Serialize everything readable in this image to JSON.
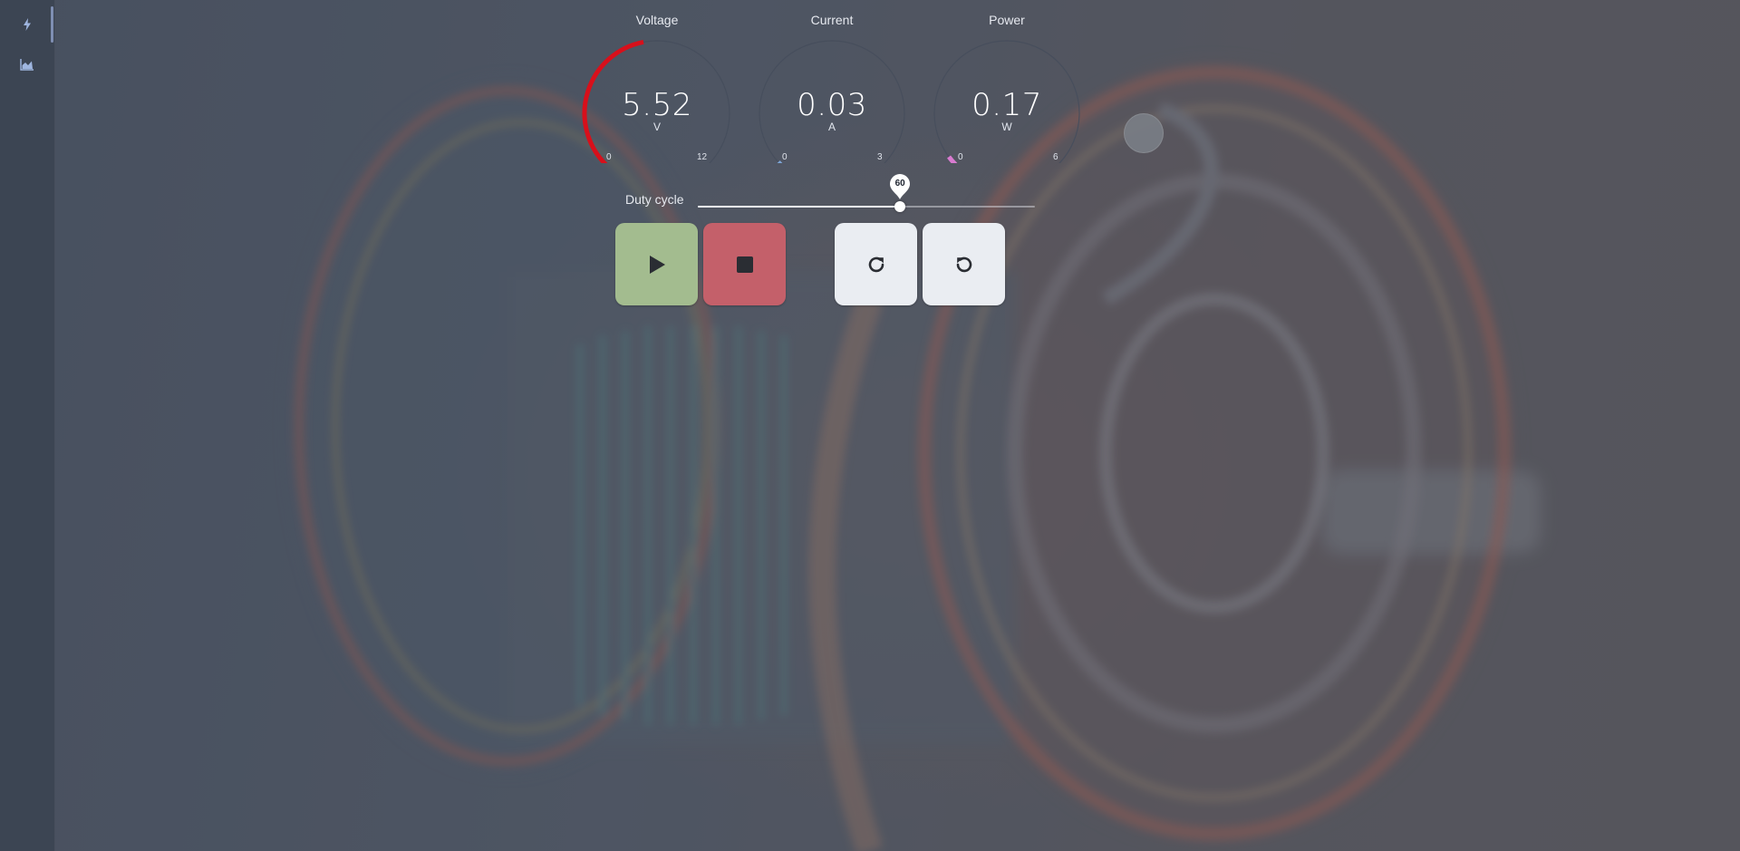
{
  "colors": {
    "voltage_arc": "#d7101b",
    "current_marker": "#7ea6d8",
    "power_marker": "#d97bd0",
    "play_button": "#a3bc8f",
    "stop_button": "#c4606a",
    "action_button": "#eaedf2",
    "sidebar_active": "#7f8fb3"
  },
  "sidebar": {
    "items": [
      {
        "icon": "lightning-icon",
        "active": true
      },
      {
        "icon": "area-chart-icon",
        "active": false
      }
    ]
  },
  "gauges": [
    {
      "title": "Voltage",
      "value": "5.52",
      "unit": "V",
      "min": "0",
      "max": "12",
      "fraction": 0.46
    },
    {
      "title": "Current",
      "value": "0.03",
      "unit": "A",
      "min": "0",
      "max": "3",
      "fraction": 0.01
    },
    {
      "title": "Power",
      "value": "0.17",
      "unit": "W",
      "min": "0",
      "max": "6",
      "fraction": 0.03
    }
  ],
  "duty_cycle": {
    "label": "Duty cycle",
    "value": 60,
    "value_text": "60",
    "min": 0,
    "max": 100
  },
  "controls": {
    "play_icon": "play-icon",
    "stop_icon": "stop-icon",
    "redo_icon": "rotate-clockwise-icon",
    "undo_icon": "rotate-counterclockwise-icon"
  }
}
